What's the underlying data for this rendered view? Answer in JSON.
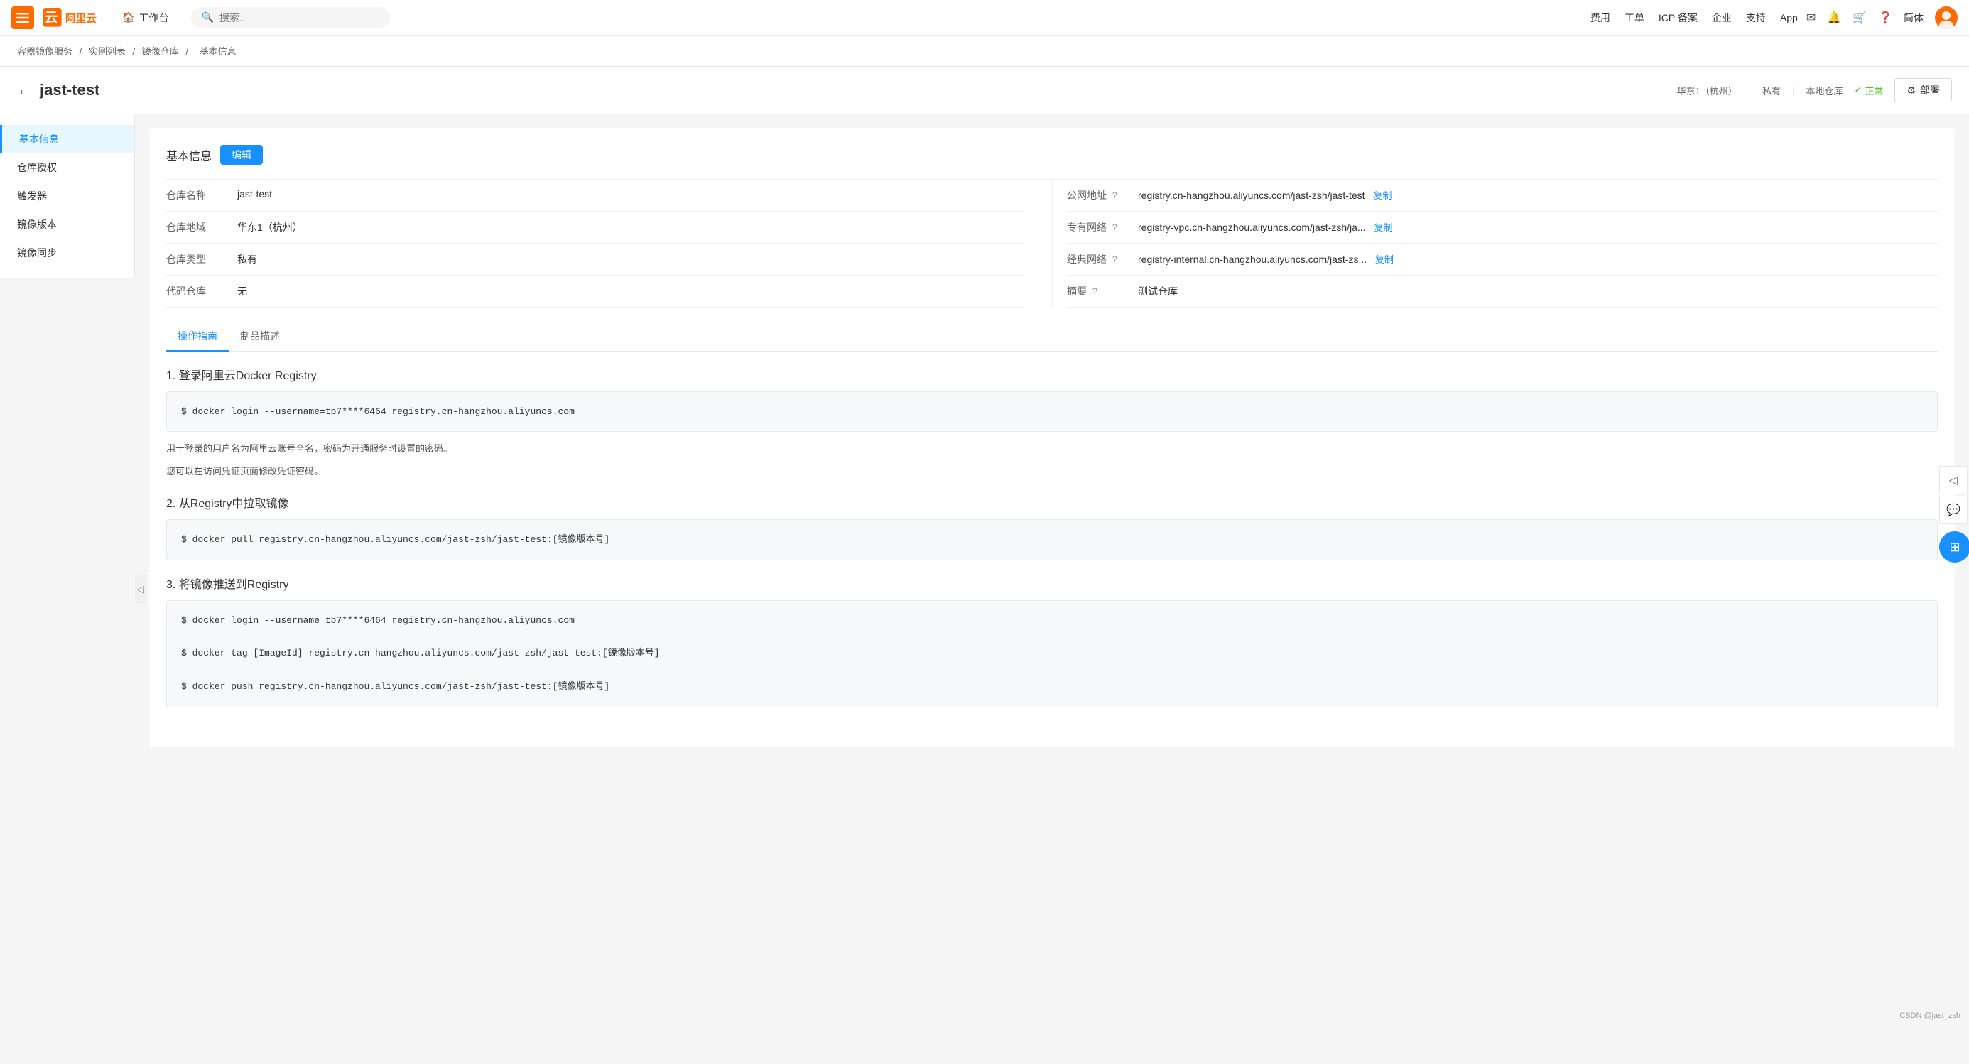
{
  "nav": {
    "menu_label": "菜单",
    "workbench": "工作台",
    "search_placeholder": "搜索...",
    "links": [
      "费用",
      "工单",
      "ICP 备案",
      "企业",
      "支持",
      "App"
    ],
    "user_text": "简体"
  },
  "breadcrumb": {
    "items": [
      "容器镜像服务",
      "实例列表",
      "镜像仓库",
      "基本信息"
    ],
    "separators": [
      "/",
      "/",
      "/"
    ]
  },
  "page": {
    "title": "jast-test",
    "meta": {
      "region": "华东1（杭州）",
      "visibility": "私有",
      "type": "本地仓库",
      "status_icon": "✓",
      "status": "正常",
      "deploy_btn": "部署"
    }
  },
  "sidebar": {
    "items": [
      {
        "label": "基本信息",
        "active": true
      },
      {
        "label": "仓库授权",
        "active": false
      },
      {
        "label": "触发器",
        "active": false
      },
      {
        "label": "镜像版本",
        "active": false
      },
      {
        "label": "镜像同步",
        "active": false
      }
    ]
  },
  "basic_info": {
    "section_title": "基本信息",
    "edit_btn": "编辑",
    "fields_left": [
      {
        "label": "仓库名称",
        "value": "jast-test"
      },
      {
        "label": "仓库地域",
        "value": "华东1（杭州）"
      },
      {
        "label": "仓库类型",
        "value": "私有"
      },
      {
        "label": "代码仓库",
        "value": "无"
      }
    ],
    "fields_right": [
      {
        "label": "公网地址",
        "value": "registry.cn-hangzhou.aliyuncs.com/jast-zsh/jast-test",
        "copy": "复制",
        "has_help": true
      },
      {
        "label": "专有网络",
        "value": "registry-vpc.cn-hangzhou.aliyuncs.com/jast-zsh/ja...",
        "copy": "复制",
        "has_help": true
      },
      {
        "label": "经典网络",
        "value": "registry-internal.cn-hangzhou.aliyuncs.com/jast-zs...",
        "copy": "复制",
        "has_help": true
      },
      {
        "label": "摘要",
        "value": "测试仓库",
        "has_help": true
      }
    ]
  },
  "tabs": {
    "items": [
      "操作指南",
      "制品描述"
    ],
    "active": 0
  },
  "instructions": {
    "steps": [
      {
        "heading": "1. 登录阿里云Docker Registry",
        "code_lines": [
          "$ docker login --username=tb7****6464  registry.cn-hangzhou.aliyuncs.com"
        ],
        "notes": [
          "用于登录的用户名为阿里云账号全名，密码为开通服务时设置的密码。",
          "您可以在访问凭证页面修改凭证密码。"
        ]
      },
      {
        "heading": "2. 从Registry中拉取镜像",
        "code_lines": [
          "$ docker pull registry.cn-hangzhou.aliyuncs.com/jast-zsh/jast-test:[镜像版本号]"
        ],
        "notes": []
      },
      {
        "heading": "3. 将镜像推送到Registry",
        "code_lines": [
          "$ docker login --username=tb7****6464  registry.cn-hangzhou.aliyuncs.com",
          "$ docker tag [ImageId] registry.cn-hangzhou.aliyuncs.com/jast-zsh/jast-test:[镜像版本号]",
          "$ docker push registry.cn-hangzhou.aliyuncs.com/jast-zsh/jast-test:[镜像版本号]"
        ],
        "notes": []
      }
    ]
  },
  "float": {
    "collapse_icon": "◁",
    "chat_icon": "💬",
    "grid_icon": "⊞"
  },
  "bottom_right": {
    "text": "CSDN @jast_zsh"
  }
}
